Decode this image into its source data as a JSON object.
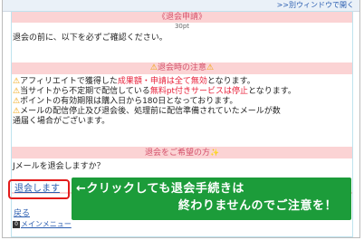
{
  "topbar": {
    "new_window_link": ">>別ウィンドウで開く"
  },
  "header": {
    "title": "《退会申請》",
    "points": "30pt"
  },
  "intro": "退会の前に、以下を必ずご確認ください。",
  "notice": {
    "title": "退会時の注意",
    "items": [
      {
        "before": "アフィリエイトで獲得した",
        "red": "成果額・申請は全て無効",
        "after": "となります。"
      },
      {
        "before": "当サイトから不定期で配信している",
        "red": "無料pt付きサービスは停止",
        "after": "となります。"
      },
      {
        "before": "ポイントの有効期限は購入日から180日となっております。",
        "red": "",
        "after": ""
      },
      {
        "before": "メールの配信停止及び退会後、処理前に配信準備されていたメールが数",
        "red": "",
        "after": ""
      }
    ],
    "continuation": "通届く場合がございます。"
  },
  "leave_section": {
    "title": "退会をご希望の方",
    "question": "Jメールを退会しますか？",
    "leave_link": "退会します"
  },
  "callout": {
    "line1": "←クリックしても退会手続きは",
    "line2": "終わりませんのでご注意を！",
    "border_color": "#e31b1b",
    "bg_color": "#1c9c3a"
  },
  "footer": {
    "back": "戻る",
    "menu_key": "0",
    "menu": "メインメニュー"
  },
  "colors": {
    "pink_band": "#fbd3d4",
    "accent_red": "#e8213a",
    "link_blue": "#2a5db0"
  }
}
